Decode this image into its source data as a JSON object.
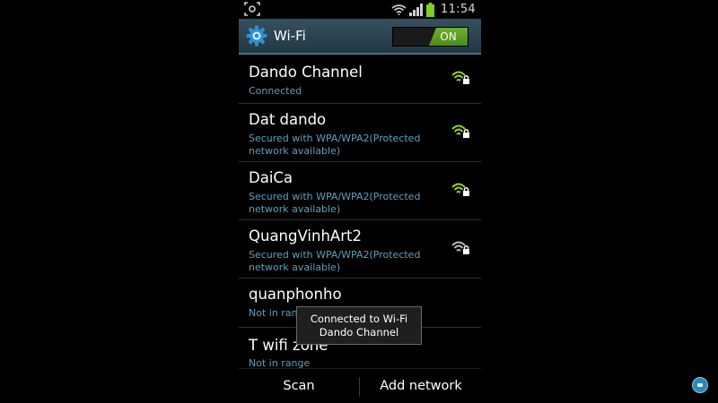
{
  "status_bar": {
    "time": "11:54",
    "icons": [
      "screenshot-icon",
      "wifi-status-icon",
      "signal-icon",
      "battery-icon"
    ],
    "battery_color": "#7ad11f"
  },
  "header": {
    "title": "Wi-Fi",
    "toggle_label": "ON",
    "icon": "gear-icon",
    "accent": "#5b9b25"
  },
  "networks": [
    {
      "name": "Dando Channel",
      "status": "Connected",
      "signal_icon": "wifi-locked-icon",
      "signal_color": "#8fd42a"
    },
    {
      "name": "Dat dando",
      "status": "Secured with WPA/WPA2(Protected network available)",
      "signal_icon": "wifi-locked-icon",
      "signal_color": "#8fd42a"
    },
    {
      "name": "DaiCa",
      "status": "Secured with WPA/WPA2(Protected network available)",
      "signal_icon": "wifi-locked-icon",
      "signal_color": "#8fd42a"
    },
    {
      "name": "QuangVinhArt2",
      "status": "Secured with WPA/WPA2(Protected network available)",
      "signal_icon": "wifi-locked-icon",
      "signal_color": "#9a9a9a"
    },
    {
      "name": "quanphonho",
      "status": "Not in range"
    },
    {
      "name": "T wifi zone",
      "status": "Not in range"
    }
  ],
  "toast": {
    "line1": "Connected to Wi-Fi",
    "line2": "Dando Channel"
  },
  "bottom_bar": {
    "scan_label": "Scan",
    "add_label": "Add network"
  },
  "colors": {
    "status_text": "#5f9ec0",
    "header_bg": "#2c4452"
  }
}
